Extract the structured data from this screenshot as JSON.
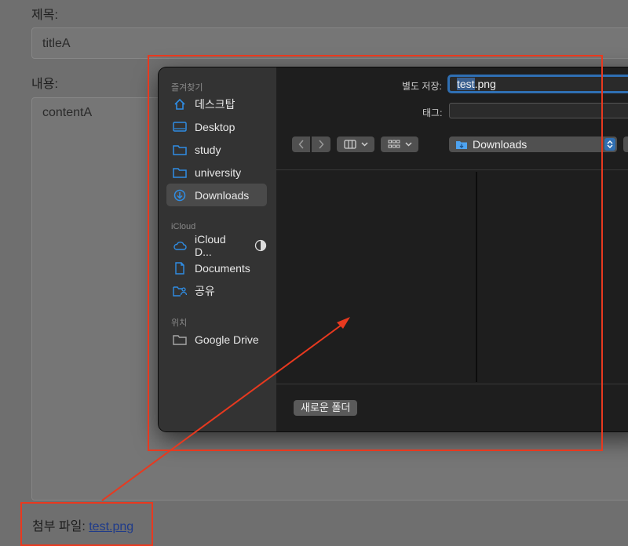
{
  "form": {
    "title_label": "제목:",
    "title_value": "titleA",
    "content_label": "내용:",
    "content_value": "contentA",
    "attachment_label": "첨부 파일:",
    "attachment_link": "test.png"
  },
  "dialog": {
    "sidebar": {
      "favorites_header": "즐겨찾기",
      "favorites": [
        {
          "label": "데스크탑",
          "icon": "home-icon"
        },
        {
          "label": "Desktop",
          "icon": "desktop-icon"
        },
        {
          "label": "study",
          "icon": "folder-icon"
        },
        {
          "label": "university",
          "icon": "folder-icon"
        },
        {
          "label": "Downloads",
          "icon": "downloads-icon",
          "selected": true
        }
      ],
      "icloud_header": "iCloud",
      "icloud": [
        {
          "label": "iCloud D...",
          "icon": "cloud-icon"
        },
        {
          "label": "Documents",
          "icon": "document-icon"
        },
        {
          "label": "공유",
          "icon": "shared-folder-icon"
        }
      ],
      "locations_header": "위치",
      "locations": [
        {
          "label": "Google Drive",
          "icon": "folder-icon"
        }
      ]
    },
    "save_as_label": "별도 저장:",
    "filename_selected": "test",
    "filename_rest": ".png",
    "tags_label": "태그:",
    "location": "Downloads",
    "new_folder_button": "새로운 폴더"
  },
  "colors": {
    "annotation": "#e8391f",
    "accent": "#2f6fb3"
  }
}
